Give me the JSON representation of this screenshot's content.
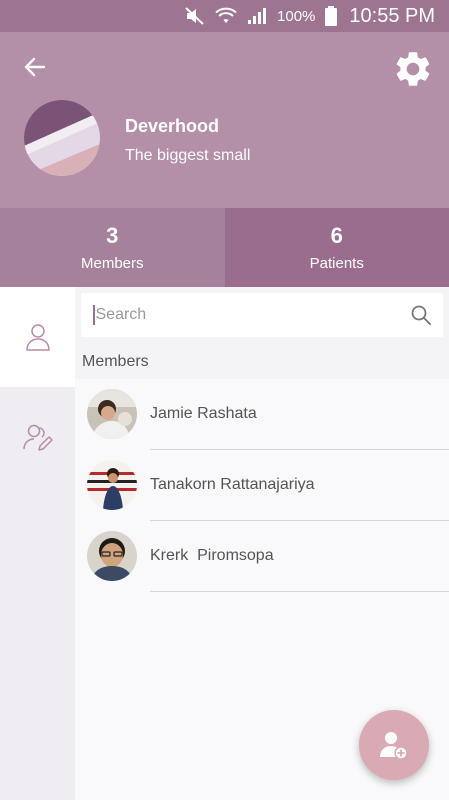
{
  "status_bar": {
    "battery": "100%",
    "time": "10:55 PM"
  },
  "header": {
    "group_name": "Deverhood",
    "group_description": "The biggest small"
  },
  "stats": {
    "members": {
      "count": "3",
      "label": "Members"
    },
    "patients": {
      "count": "6",
      "label": "Patients"
    }
  },
  "sidebar": {
    "tabs": [
      {
        "icon": "person-icon",
        "active": true
      },
      {
        "icon": "people-edit-icon",
        "active": false
      }
    ]
  },
  "search": {
    "placeholder": "Search",
    "value": ""
  },
  "members_section": {
    "title": "Members",
    "items": [
      {
        "name": "Jamie Rashata"
      },
      {
        "name": "Tanakorn Rattanajariya"
      },
      {
        "name": "Krerk  Piromsopa"
      }
    ]
  },
  "colors": {
    "header": "#b38fa8",
    "status_bar": "#9e7590",
    "members_tab": "#a5819b",
    "patients_tab": "#9a6c8d",
    "fab": "#d9aab4"
  }
}
